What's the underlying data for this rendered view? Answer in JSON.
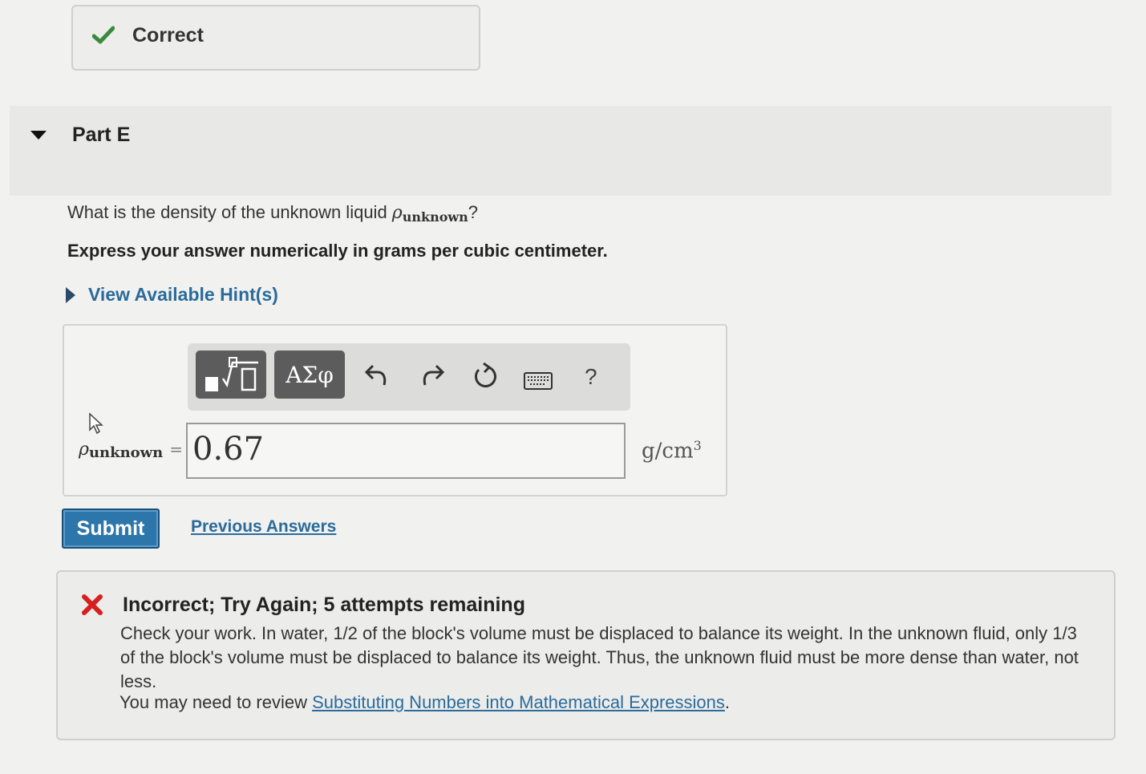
{
  "correct_feedback": {
    "text": "Correct"
  },
  "part": {
    "title": "Part E"
  },
  "question": {
    "prefix": "What is the density of the unknown liquid ",
    "symbol": "ρ",
    "subscript": "unknown",
    "suffix": "?"
  },
  "instruction": "Express your answer numerically in grams per cubic centimeter.",
  "hints_link": "View Available Hint(s)",
  "toolbar": {
    "greek_label": "ΑΣφ",
    "help_label": "?"
  },
  "answer": {
    "label_symbol": "ρ",
    "label_subscript": "unknown",
    "equals": "=",
    "value": "0.67",
    "unit_base": "g/cm",
    "unit_exponent": "3"
  },
  "submit_label": "Submit",
  "previous_answers_label": "Previous Answers",
  "incorrect_feedback": {
    "title": "Incorrect; Try Again; 5 attempts remaining",
    "body": "Check your work. In water, 1/2 of the block's volume must be displaced to balance its weight. In the unknown fluid, only 1/3 of the block's volume must be displaced to balance its weight. Thus, the unknown fluid must be more dense than water, not less.",
    "review_prefix": "You may need to review ",
    "review_link": "Substituting Numbers into Mathematical Expressions",
    "review_suffix": "."
  },
  "colors": {
    "accent": "#2a6b9a",
    "submit": "#2d76ab",
    "correct": "#3a8a3a",
    "incorrect": "#d62020"
  }
}
